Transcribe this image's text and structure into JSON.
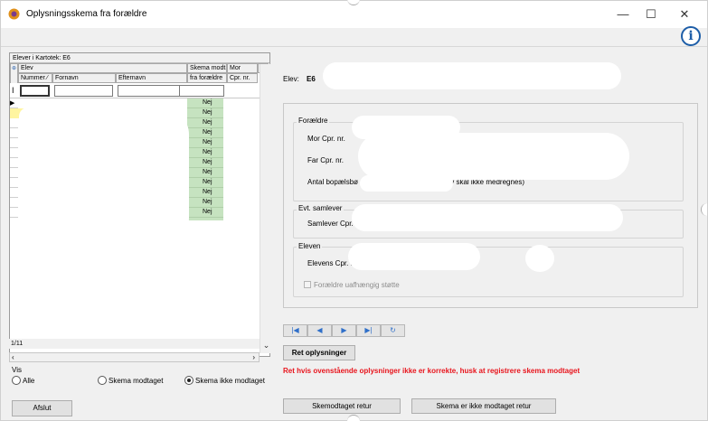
{
  "window": {
    "title": "Oplysningsskema fra forældre",
    "controls": {
      "minimize": "—",
      "maximize": "☐",
      "close": "✕"
    },
    "info_icon": "i"
  },
  "grid": {
    "caption": "Elever i Kartotek: E6",
    "group_elev": "Elev",
    "col_skema_line1": "Skema modt.",
    "col_skema_line2": "fra forældre",
    "col_mor_line1": "Mor",
    "col_mor_line2": "Cpr. nr.",
    "col_nummer": "Nummer",
    "col_fornavn": "Fornavn",
    "col_efternavn": "Efternavn",
    "filter_marker": "I",
    "skema_values": [
      "Nej",
      "Nej",
      "Nej",
      "Nej",
      "Nej",
      "Nej",
      "Nej",
      "Nej",
      "Nej",
      "Nej",
      "Nej",
      "Nej"
    ],
    "record_count": "1/11"
  },
  "vis": {
    "label": "Vis",
    "options": [
      {
        "label": "Alle",
        "checked": false
      },
      {
        "label": "Skema modtaget",
        "checked": false
      },
      {
        "label": "Skema ikke modtaget",
        "checked": true
      }
    ]
  },
  "buttons": {
    "afslut": "Afslut",
    "ret_oplysninger": "Ret oplysninger",
    "skemodtaget_retur": "Skemodtaget retur",
    "skema_ikke_modtaget_retur": "Skema er ikke modtaget retur"
  },
  "details": {
    "elev_label": "Elev:",
    "elev_value": "E6",
    "foraeldre_title": "Forældre",
    "mor_label": "Mor   Cpr. nr.",
    "far_label": "Far   Cpr. nr.",
    "antal_label_start": "Antal bopælsbø",
    "antal_label_end": "elv skal ikke medregnes)",
    "samlever_title": "Evt. samlever",
    "samlever_label": "Samlever Cpr. n",
    "eleven_title": "Eleven",
    "elevens_label": "Elevens Cpr. n",
    "uafhaengig_label": "Forældre uafhængig støtte"
  },
  "nav": {
    "first": "|◀",
    "prev": "◀",
    "next": "▶",
    "last": "▶|",
    "refresh": "↻"
  },
  "warning": "Ret hvis ovenstående oplysninger ikke er korrekte, husk at registrere skema modtaget",
  "colors": {
    "warning_red": "#e8141c",
    "nej_green": "#c6e3c0",
    "nav_blue": "#2f6fc9",
    "info_blue": "#1e5ea8"
  }
}
